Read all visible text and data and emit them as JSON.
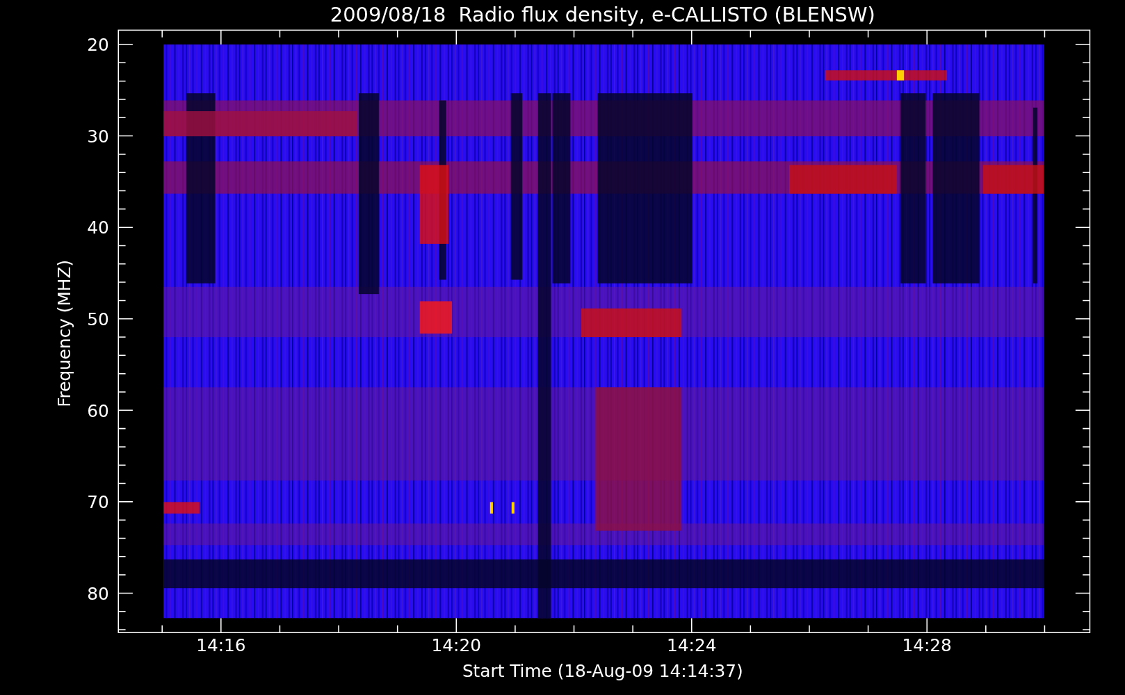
{
  "title": "2009/08/18  Radio flux density, e-CALLISTO (BLENSW)",
  "y_axis": {
    "label": "Frequency (MHZ)",
    "ticks": [
      "20",
      "30",
      "40",
      "50",
      "60",
      "70",
      "80"
    ]
  },
  "x_axis": {
    "label": "Start Time (18-Aug-09 14:14:37)",
    "ticks": [
      "14:16",
      "14:20",
      "14:24",
      "14:28"
    ]
  }
}
